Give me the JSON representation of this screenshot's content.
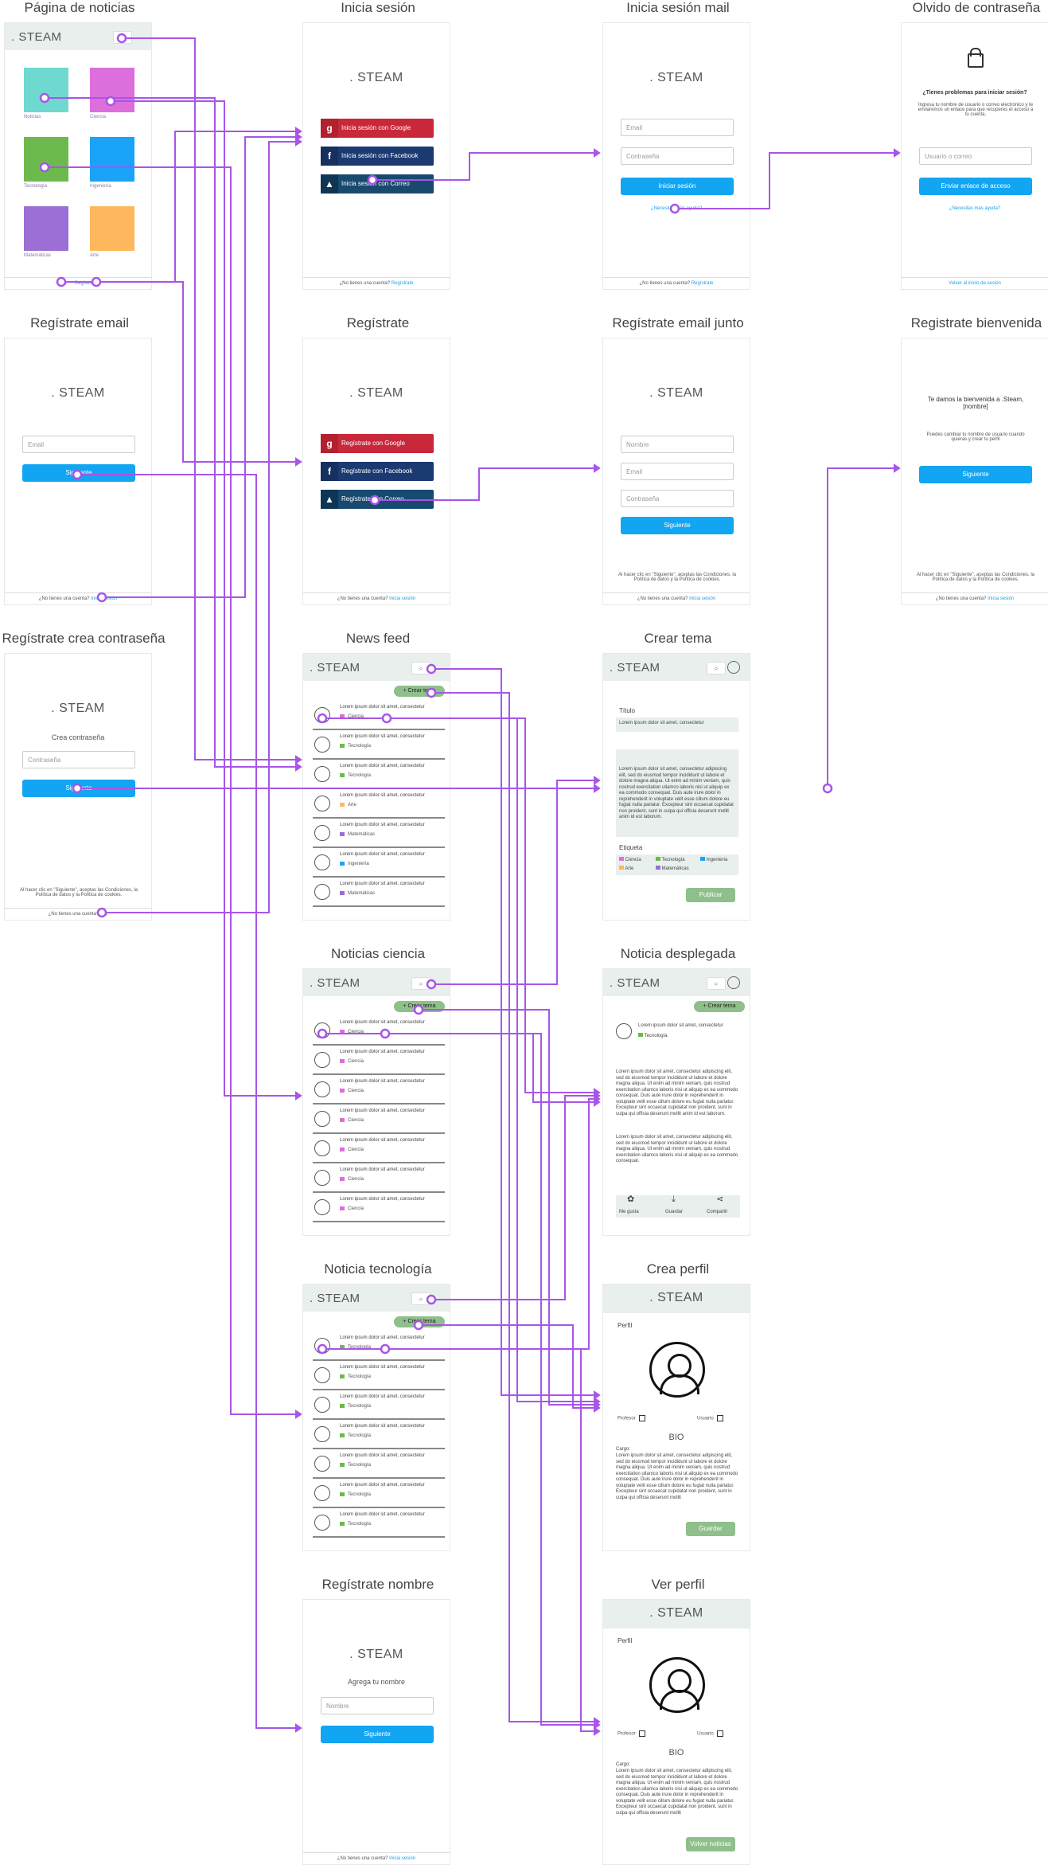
{
  "brand": ". STEAM",
  "titles": {
    "noticias": "Página de noticias",
    "login": "Inicia sesión",
    "login_mail": "Inicia sesión mail",
    "forgot": "Olvido de contraseña",
    "reg_email": "Regístrate email",
    "register": "Regístrate",
    "reg_email_junto": "Regístrate email junto",
    "reg_bienvenida": "Registrate bienvenida",
    "reg_pass": "Regístrate crea contraseña",
    "news_feed": "News feed",
    "crear_tema": "Crear tema",
    "noticias_ciencia": "Noticias ciencia",
    "noticia_desplegada": "Noticia desplegada",
    "noticia_tecnologia": "Noticia tecnología",
    "crea_perfil": "Crea perfil",
    "reg_nombre": "Regístrate nombre",
    "ver_perfil": "Ver perfil"
  },
  "categories": [
    "Noticias",
    "Ciencia",
    "Tecnología",
    "Ingeniería",
    "Matemáticas",
    "Arte"
  ],
  "tile_colors": [
    "#6fd9cf",
    "#dc6fdc",
    "#6cba4e",
    "#1aa3f8",
    "#9b6fd5",
    "#ffb75d"
  ],
  "footer_no_account": "¿No tienes una cuenta?",
  "footer_register": "Regístrate",
  "footer_login": "Inicia sesión",
  "footer_login_short": "Inic",
  "footer_volver": "Volver al inicio de sesión",
  "login": {
    "google": "Inicia sesión con Google",
    "facebook": "Inicia sesión con Facebook",
    "correo": "Inicia sesión con Correo"
  },
  "login_mail": {
    "email": "Email",
    "password": "Contraseña",
    "button": "Iniciar sesión",
    "help": "¿Necesitas más ayuda?"
  },
  "forgot": {
    "heading": "¿Tienes problemas para iniciar sesión?",
    "body": "Ingresa tu nombre de usuario o correo electrónico y te enviaremos un enlace para que recuperes el acceso a tu cuenta.",
    "input": "Usuario o correo",
    "button": "Enviar enlace de acceso",
    "help": "¿Necesitas más ayuda?"
  },
  "register": {
    "google": "Regístrate con Google",
    "facebook": "Regístrate con Facebook",
    "correo": "Regístrate con Correo"
  },
  "reg_email": {
    "email": "Email",
    "button": "Siguiente"
  },
  "reg_junto": {
    "name": "Nombre",
    "email": "Email",
    "password": "Contraseña",
    "button": "Siguiente"
  },
  "terms": "Al hacer clic en \"Siguiente\", aceptas las Condiciones, la Política de datos y la Política de cookies.",
  "bienvenida": {
    "heading": "Te damos la bienvenida a .Steam, [nombre]",
    "body": "Puedes cambiar tu nombre de usuario cuando quieras y crear tu perfil",
    "button": "Siguiente"
  },
  "reg_pass": {
    "heading": "Crea contraseña",
    "input": "Contraseña",
    "button": "Siguiente"
  },
  "reg_nombre": {
    "heading": "Agrega tu nombre",
    "input": "Nombre",
    "button": "Siguiente"
  },
  "crear_tema_btn": "Crear tema",
  "item_text": "Lorem ipsum dolor sit amet, consectetur",
  "feed_tags": [
    "Ciencia",
    "Tecnología",
    "Tecnología",
    "Arte",
    "Matemáticas",
    "Ingeniería",
    "Matemáticas"
  ],
  "ciencia_tag": "Ciencia",
  "tecnologia_tag": "Tecnología",
  "crear_tema": {
    "titulo": "Título",
    "titulo_value": "Lorem ipsum dolor sit amet, consectetur",
    "body": "Lorem ipsum dolor sit amet, consectetur adipiscing elit, sed do eiusmod tempor incididunt ut labore et dolore magna aliqua. Ut enim ad minim veniam, quis nostrud exercitation ullamco laboris nisi ut aliquip ex ea commodo consequat. Duis aute irure dolor in reprehenderit in voluptate velit esse cillum dolore eu fugiat nulla pariatur. Excepteur sint occaecat cupidatat non proident, sunt in culpa qui officia deserunt mollit anim id est laborum.",
    "etiqueta": "Etiqueta",
    "publicar": "Publicar"
  },
  "desplegada": {
    "head": "Lorem ipsum dolor sit amet, consectetur",
    "tag": "Tecnología",
    "p1": "Lorem ipsum dolor sit amet, consectetur adipiscing elit, sed do eiusmod tempor incididunt ut labore et dolore magna aliqua. Ut enim ad minim veniam, quis nostrud exercitation ullamco laboris nisi ut aliquip ex ea commodo consequat. Duis aute irure dolor in reprehenderit in voluptate velit esse cillum dolore eu fugiat nulla pariatur. Excepteur sint occaecat cupidatat non proident, sunt in culpa qui officia deserunt mollit anim id est laborum.",
    "p2": "Lorem ipsum dolor sit amet, consectetur adipiscing elit, sed do eiusmod tempor incididunt ut labore et dolore magna aliqua. Ut enim ad minim veniam, quis nostrud exercitation ullamco laboris nisi ut aliquip ex ea commodo consequat.",
    "like": "Me gusta",
    "save": "Guardar",
    "share": "Compartir"
  },
  "perfil": {
    "label": "Perfil",
    "profesor": "Profesor",
    "usuario": "Usuario",
    "bio": "BIO",
    "cargo": "Cargo:",
    "text": "Lorem ipsum dolor sit amet, consectetur adipiscing elit, sed do eiusmod tempor incididunt ut labore et dolore magna aliqua. Ut enim ad minim veniam, quis nostrud exercitation ullamco laboris nisi ut aliquip ex ea commodo consequat. Duis aute irure dolor in reprehenderit in voluptate velit esse cillum dolore eu fugiat nulla pariatur. Excepteur sint occaecat cupidatat non proident, sunt in culpa qui officia deserunt mollit",
    "guardar": "Guardar",
    "volver": "Volver noticias"
  },
  "colors": {
    "link": "#a855e8",
    "primary": "#12a5f2",
    "green": "#8fbf8a",
    "header": "#e8efec"
  }
}
